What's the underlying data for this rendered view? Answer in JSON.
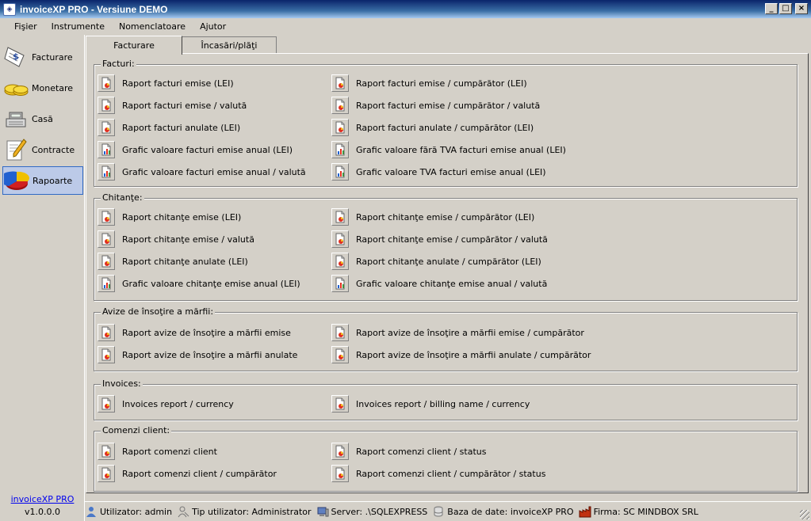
{
  "window": {
    "title": "invoiceXP PRO - Versiune DEMO"
  },
  "menu": [
    "Fişier",
    "Instrumente",
    "Nomenclatoare",
    "Ajutor"
  ],
  "nav": [
    {
      "label": "Facturare",
      "icon": "invoice-icon"
    },
    {
      "label": "Monetare",
      "icon": "coins-icon"
    },
    {
      "label": "Casă",
      "icon": "cash-register-icon"
    },
    {
      "label": "Contracte",
      "icon": "contract-pen-icon"
    },
    {
      "label": "Rapoarte",
      "icon": "pie-chart-icon",
      "active": true
    }
  ],
  "footer": {
    "link": "invoiceXP PRO",
    "version": "v1.0.0.0"
  },
  "tabs": [
    "Facturare",
    "Încasări/plăţi"
  ],
  "groups": [
    {
      "title": "Facturi:",
      "items": [
        {
          "label": "Raport facturi emise (LEI)",
          "icon": "report-icon"
        },
        {
          "label": "Raport facturi emise / cumpărător (LEI)",
          "icon": "report-icon"
        },
        {
          "label": "Raport facturi emise / valută",
          "icon": "report-icon"
        },
        {
          "label": "Raport facturi emise / cumpărător / valută",
          "icon": "report-icon"
        },
        {
          "label": "Raport facturi anulate (LEI)",
          "icon": "report-icon"
        },
        {
          "label": "Raport facturi anulate / cumpărător (LEI)",
          "icon": "report-icon"
        },
        {
          "label": "Grafic valoare facturi emise anual (LEI)",
          "icon": "chart-icon"
        },
        {
          "label": "Grafic valoare fără TVA facturi emise anual (LEI)",
          "icon": "chart-icon"
        },
        {
          "label": "Grafic valoare facturi emise anual / valută",
          "icon": "chart-icon"
        },
        {
          "label": "Grafic valoare TVA facturi emise anual (LEI)",
          "icon": "chart-icon"
        }
      ]
    },
    {
      "title": "Chitanţe:",
      "items": [
        {
          "label": "Raport chitanţe emise (LEI)",
          "icon": "report-icon"
        },
        {
          "label": "Raport chitanţe emise / cumpărător (LEI)",
          "icon": "report-icon"
        },
        {
          "label": "Raport chitanţe emise / valută",
          "icon": "report-icon"
        },
        {
          "label": "Raport chitanţe emise / cumpărător  / valută",
          "icon": "report-icon"
        },
        {
          "label": "Raport chitanţe anulate (LEI)",
          "icon": "report-icon"
        },
        {
          "label": "Raport chitanţe anulate / cumpărător (LEI)",
          "icon": "report-icon"
        },
        {
          "label": "Grafic valoare chitanţe emise anual (LEI)",
          "icon": "chart-icon"
        },
        {
          "label": "Grafic valoare chitanţe emise anual / valută",
          "icon": "chart-icon"
        }
      ]
    },
    {
      "title": "Avize de însoţire a mărfii:",
      "items": [
        {
          "label": "Raport avize de însoţire a mărfii emise",
          "icon": "report-icon"
        },
        {
          "label": "Raport avize de însoţire a mărfii emise / cumpărător",
          "icon": "report-icon"
        },
        {
          "label": "Raport avize de însoţire a mărfii anulate",
          "icon": "report-icon"
        },
        {
          "label": "Raport avize de însoţire a mărfii anulate / cumpărător",
          "icon": "report-icon"
        }
      ]
    },
    {
      "title": "Invoices:",
      "items": [
        {
          "label": "Invoices report / currency",
          "icon": "report-icon"
        },
        {
          "label": "Invoices report / billing name / currency",
          "icon": "report-icon"
        }
      ]
    },
    {
      "title": "Comenzi client:",
      "items": [
        {
          "label": "Raport comenzi client",
          "icon": "report-icon"
        },
        {
          "label": "Raport comenzi client / status",
          "icon": "report-icon"
        },
        {
          "label": "Raport comenzi client / cumpărător",
          "icon": "report-icon"
        },
        {
          "label": "Raport comenzi client / cumpărător / status",
          "icon": "report-icon"
        }
      ]
    }
  ],
  "status": [
    {
      "text": "Utilizator: admin",
      "icon": "user-icon"
    },
    {
      "text": "Tip utilizator: Administrator",
      "icon": "user-type-icon"
    },
    {
      "text": "Server: .\\SQLEXPRESS",
      "icon": "server-icon"
    },
    {
      "text": "Baza de date: invoiceXP PRO",
      "icon": "database-icon"
    },
    {
      "text": "Firma: SC MINDBOX SRL",
      "icon": "company-icon"
    }
  ]
}
